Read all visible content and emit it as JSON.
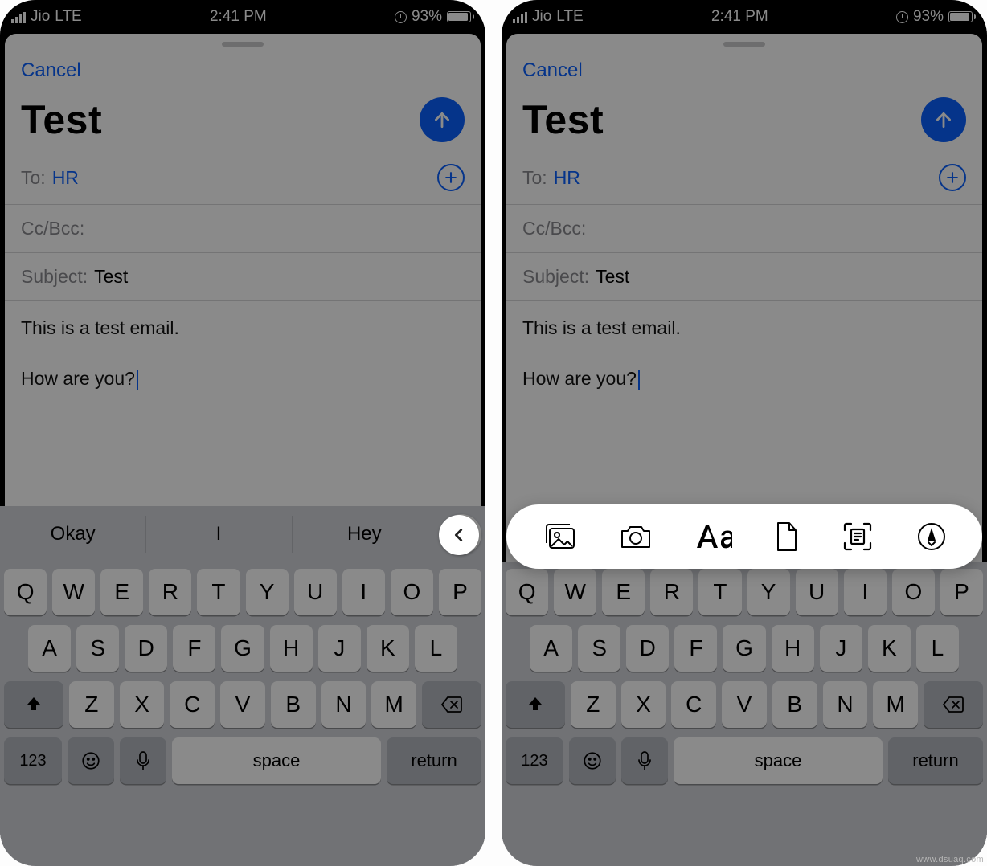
{
  "status": {
    "carrier": "Jio",
    "network": "LTE",
    "time": "2:41 PM",
    "battery_pct": "93%"
  },
  "mail": {
    "cancel": "Cancel",
    "title": "Test",
    "to_label": "To:",
    "to_value": "HR",
    "cc_label": "Cc/Bcc:",
    "subject_label": "Subject:",
    "subject_value": "Test",
    "body_line1": "This is a test email.",
    "body_line2": "How are you?"
  },
  "quicktype": {
    "suggestions": [
      "Okay",
      "I",
      "Hey"
    ]
  },
  "attach_icons": [
    "photo-library-icon",
    "camera-icon",
    "text-format-icon",
    "file-icon",
    "scan-document-icon",
    "markup-icon"
  ],
  "keyboard": {
    "row1": [
      "Q",
      "W",
      "E",
      "R",
      "T",
      "Y",
      "U",
      "I",
      "O",
      "P"
    ],
    "row2": [
      "A",
      "S",
      "D",
      "F",
      "G",
      "H",
      "J",
      "K",
      "L"
    ],
    "row3": [
      "Z",
      "X",
      "C",
      "V",
      "B",
      "N",
      "M"
    ],
    "nums": "123",
    "space": "space",
    "ret": "return"
  },
  "watermark": "www.dsuaq.com"
}
